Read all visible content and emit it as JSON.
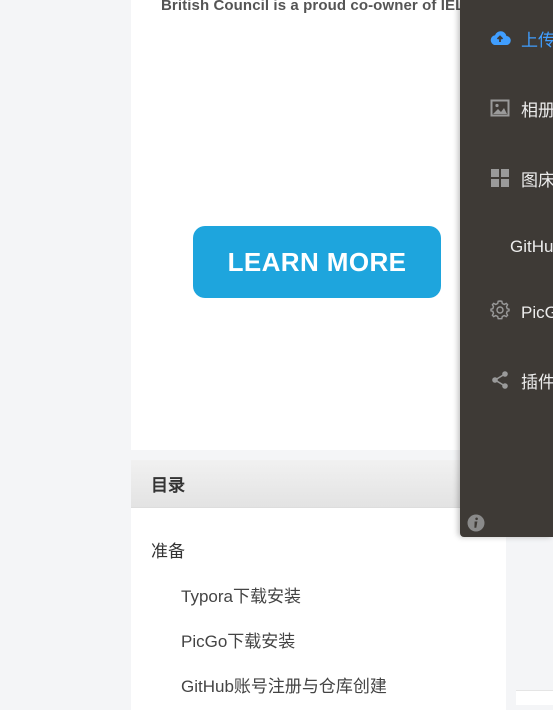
{
  "ad": {
    "tagline": "British Council is a proud co-owner of IELTS",
    "button_label": "LEARN MORE"
  },
  "toc": {
    "title": "目录",
    "items": [
      {
        "label": "准备",
        "level": 1
      },
      {
        "label": "Typora下载安装",
        "level": 2
      },
      {
        "label": "PicGo下载安装",
        "level": 2
      },
      {
        "label": "GitHub账号注册与仓库创建",
        "level": 2
      }
    ]
  },
  "drawer": {
    "items": [
      {
        "label": "上传区",
        "icon": "cloud-upload-icon",
        "active": true
      },
      {
        "label": "相册",
        "icon": "image-icon"
      },
      {
        "label": "图床设置",
        "icon": "grid-icon"
      },
      {
        "label": "GitHub图床",
        "icon": ""
      },
      {
        "label": "PicGo设置",
        "icon": "gear-icon"
      },
      {
        "label": "插件设置",
        "icon": "share-icon"
      }
    ],
    "info_icon": "info-icon"
  },
  "colors": {
    "drawer_bg": "#3e3a36",
    "accent": "#409eff",
    "learn_more_bg": "#1ea5dd"
  }
}
